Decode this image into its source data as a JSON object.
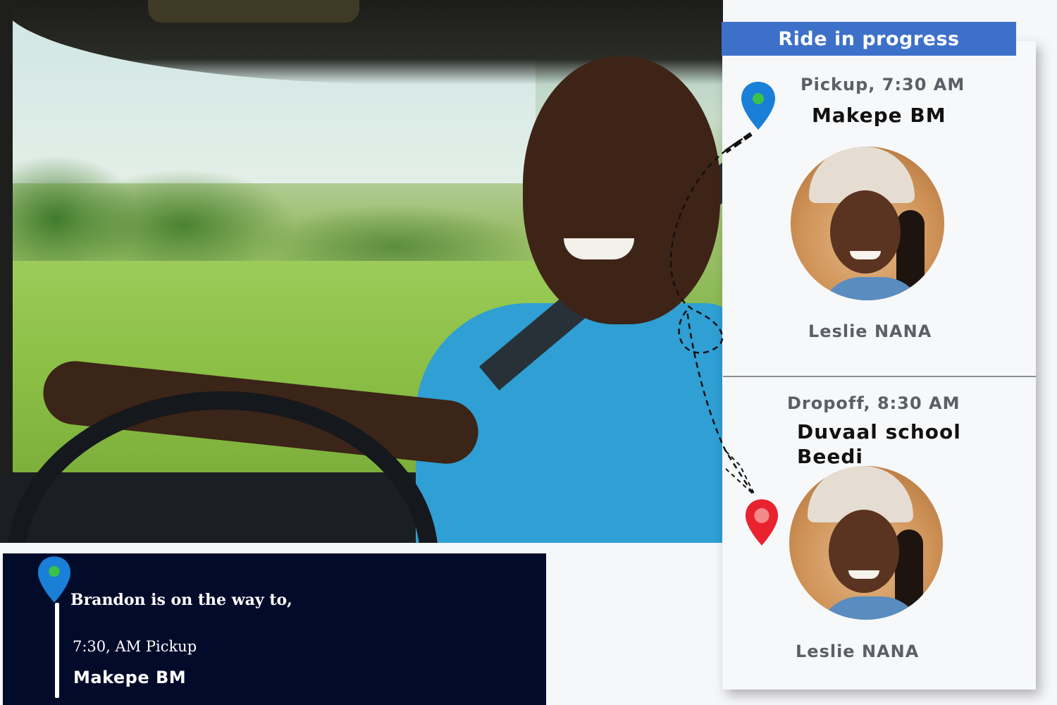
{
  "card": {
    "title": "Ride in progress",
    "pickup": {
      "time_label": "Pickup, 7:30 AM",
      "place": "Makepe BM",
      "passenger": "Leslie NANA",
      "pin_icon": "location-pin-icon",
      "pin_color": "#1a7fd6"
    },
    "dropoff": {
      "time_label": "Dropoff, 8:30 AM",
      "place": "Duvaal school Beedi",
      "passenger": "Leslie NANA",
      "pin_icon": "location-pin-icon",
      "pin_color": "#e8232e"
    }
  },
  "status_bar": {
    "message": "Brandon is on the way to,",
    "time_label": "7:30, AM Pickup",
    "place": "Makepe BM",
    "pin_icon": "location-pin-icon",
    "pin_color": "#1a7fd6"
  },
  "colors": {
    "header_blue": "#3d70c9",
    "status_bg": "#030b2a",
    "card_bg": "#f7f8fa"
  }
}
